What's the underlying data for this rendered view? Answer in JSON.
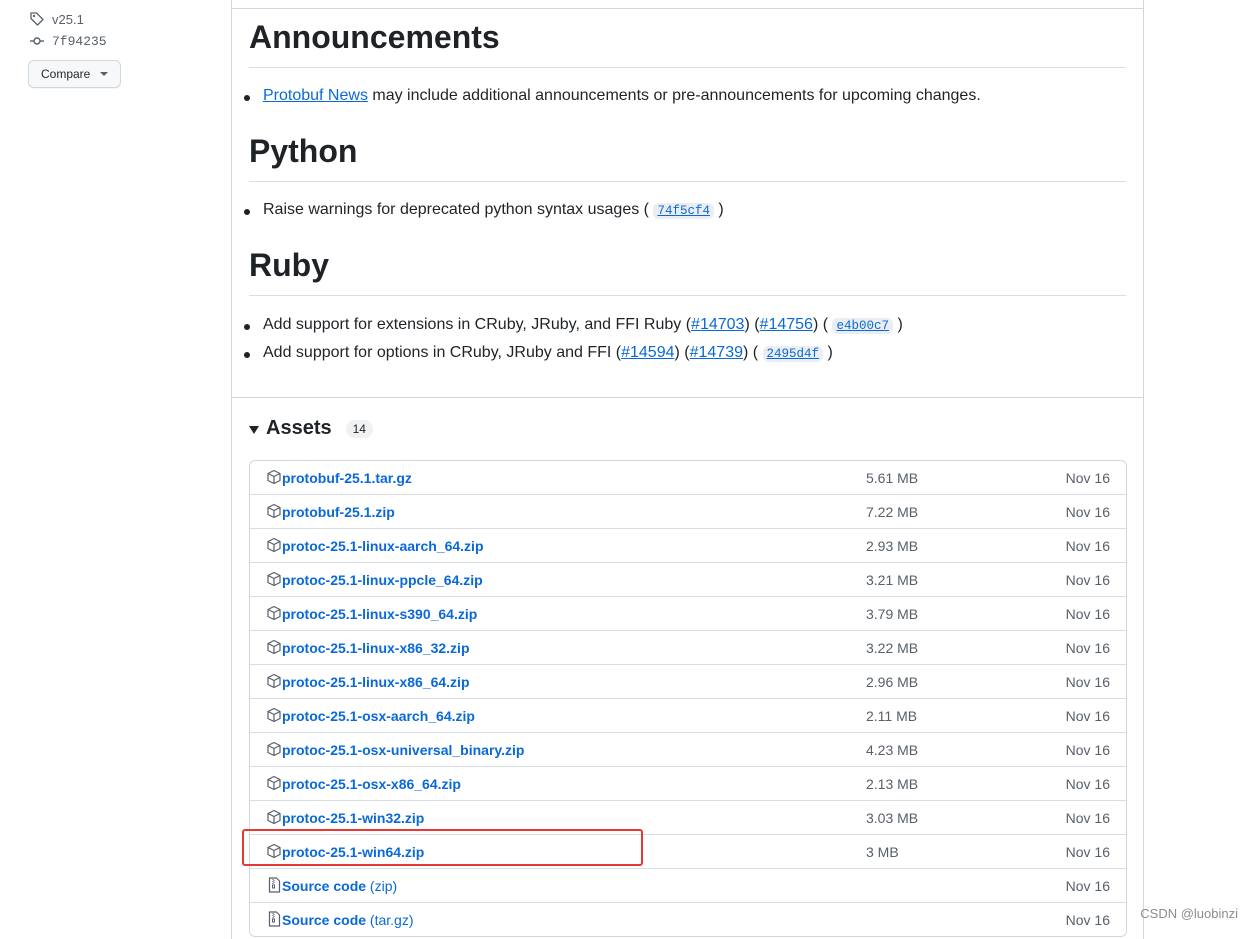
{
  "sidebar": {
    "tag": "v25.1",
    "commit": "7f94235",
    "compare_label": "Compare"
  },
  "announcements": {
    "heading": "Announcements",
    "link": "Protobuf News",
    "text": " may include additional announcements or pre-announcements for upcoming changes."
  },
  "python": {
    "heading": "Python",
    "text": "Raise warnings for deprecated python syntax usages ( ",
    "sha": "74f5cf4",
    "close": " )"
  },
  "ruby": {
    "heading": "Ruby",
    "items": [
      {
        "text": "Add support for extensions in CRuby, JRuby, and FFI Ruby (",
        "link1": "#14703",
        "mid": ") (",
        "link2": "#14756",
        "mid2": ") ( ",
        "sha": "e4b00c7",
        "close": " )"
      },
      {
        "text": "Add support for options in CRuby, JRuby and FFI (",
        "link1": "#14594",
        "mid": ") (",
        "link2": "#14739",
        "mid2": ") ( ",
        "sha": "2495d4f",
        "close": " )"
      }
    ]
  },
  "assets": {
    "title": "Assets",
    "count": "14",
    "rows": [
      {
        "name": "protobuf-25.1.tar.gz",
        "size": "5.61 MB",
        "date": "Nov 16"
      },
      {
        "name": "protobuf-25.1.zip",
        "size": "7.22 MB",
        "date": "Nov 16"
      },
      {
        "name": "protoc-25.1-linux-aarch_64.zip",
        "size": "2.93 MB",
        "date": "Nov 16"
      },
      {
        "name": "protoc-25.1-linux-ppcle_64.zip",
        "size": "3.21 MB",
        "date": "Nov 16"
      },
      {
        "name": "protoc-25.1-linux-s390_64.zip",
        "size": "3.79 MB",
        "date": "Nov 16"
      },
      {
        "name": "protoc-25.1-linux-x86_32.zip",
        "size": "3.22 MB",
        "date": "Nov 16"
      },
      {
        "name": "protoc-25.1-linux-x86_64.zip",
        "size": "2.96 MB",
        "date": "Nov 16"
      },
      {
        "name": "protoc-25.1-osx-aarch_64.zip",
        "size": "2.11 MB",
        "date": "Nov 16"
      },
      {
        "name": "protoc-25.1-osx-universal_binary.zip",
        "size": "4.23 MB",
        "date": "Nov 16"
      },
      {
        "name": "protoc-25.1-osx-x86_64.zip",
        "size": "2.13 MB",
        "date": "Nov 16"
      },
      {
        "name": "protoc-25.1-win32.zip",
        "size": "3.03 MB",
        "date": "Nov 16"
      },
      {
        "name": "protoc-25.1-win64.zip",
        "size": "3 MB",
        "date": "Nov 16"
      }
    ],
    "source": [
      {
        "name": "Source code",
        "sub": "(zip)",
        "date": "Nov 16"
      },
      {
        "name": "Source code",
        "sub": "(tar.gz)",
        "date": "Nov 16"
      }
    ]
  },
  "watermark": "CSDN @luobinzi",
  "colors": {
    "link": "#0969da",
    "highlight": "#e53935"
  },
  "icons": {
    "tag": "tag-icon",
    "commit": "git-commit-icon",
    "package": "package-icon",
    "zip": "file-zip-icon"
  }
}
